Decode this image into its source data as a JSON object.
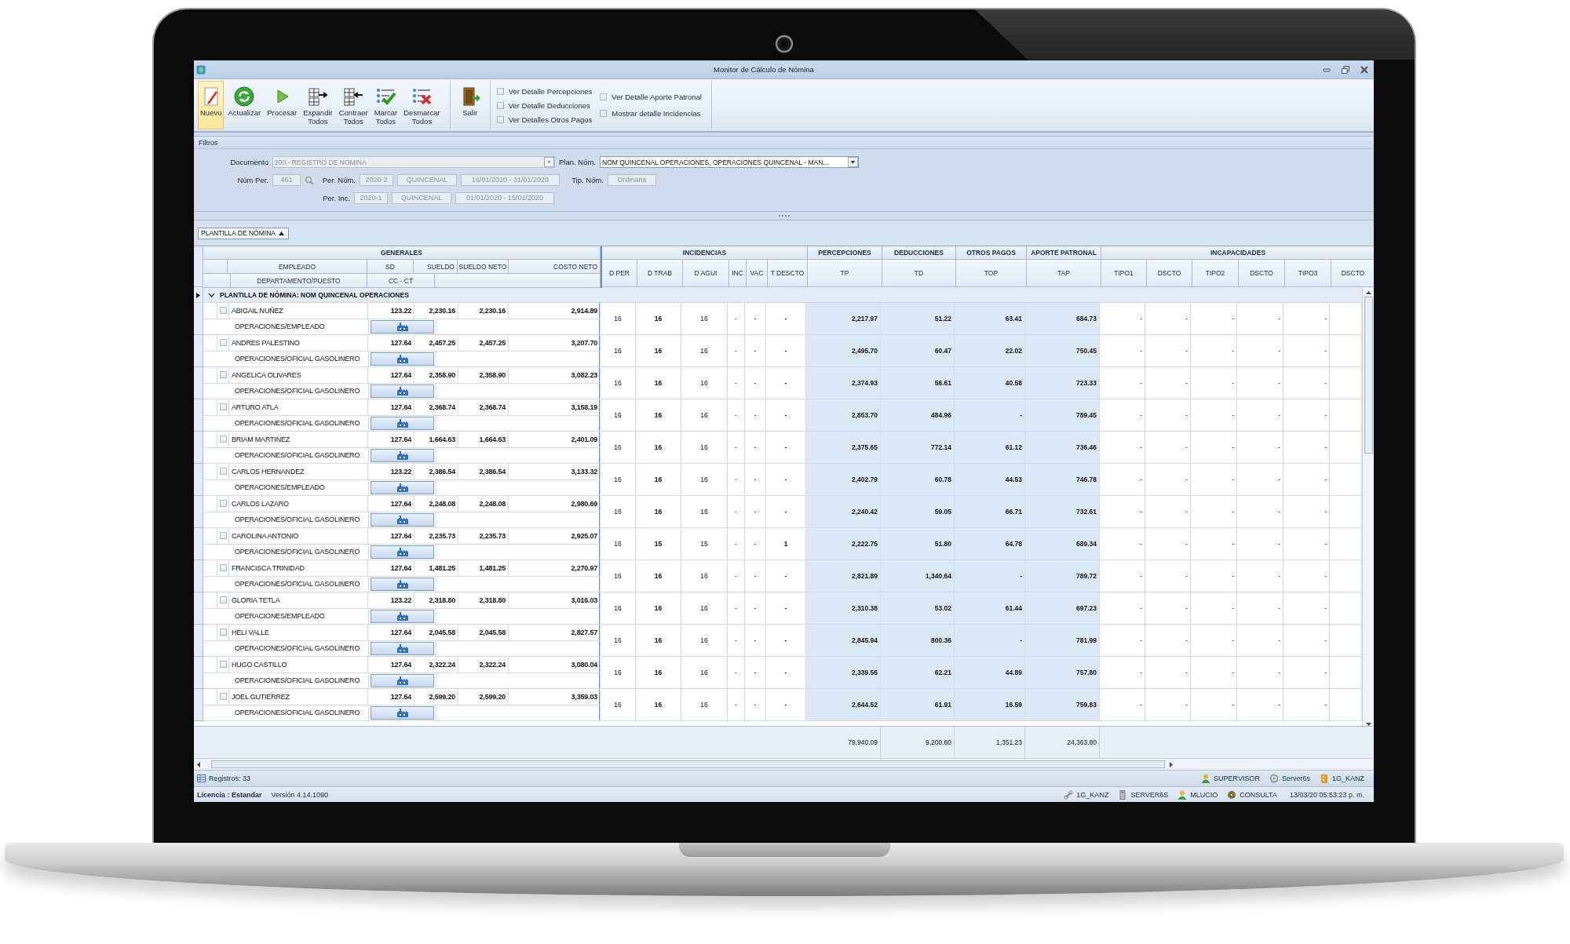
{
  "window": {
    "title": "Monitor de Cálculo de Nómina"
  },
  "toolbar": {
    "buttons": [
      {
        "label": "Nuevo",
        "selected": true
      },
      {
        "label": "Actualizar",
        "selected": false
      },
      {
        "label": "Procesar",
        "selected": false
      },
      {
        "label": "Expandir Todos",
        "selected": false
      },
      {
        "label": "Contraer Todos",
        "selected": false
      },
      {
        "label": "Marcar Todos",
        "selected": false
      },
      {
        "label": "Desmarcar Todos",
        "selected": false
      },
      {
        "label": "Salir",
        "selected": false
      }
    ],
    "options": [
      {
        "label": "Ver Detalle Percepciones",
        "checked": false
      },
      {
        "label": "Ver Detalle Deducciones",
        "checked": false
      },
      {
        "label": "Ver Detalles Otros Pagos",
        "checked": false
      },
      {
        "label": "Ver Detalle Aporte Patronal",
        "checked": false
      },
      {
        "label": "Mostrar detalle Incidencias",
        "checked": false
      }
    ]
  },
  "filters": {
    "title": "Filtros",
    "documento": {
      "label": "Documento",
      "value": "200 - REGISTRO DE NOMINA",
      "disabled": true
    },
    "plan_nom": {
      "label": "Plan. Nóm.",
      "value": "NOM QUINCENAL OPERACIONES, OPERACIONES QUINCENAL - MAN...",
      "disabled": false
    },
    "num_per": {
      "label": "Núm Per.",
      "value": "461"
    },
    "per_nom": {
      "label": "Per. Nóm.",
      "values": [
        "2020-2",
        "QUINCENAL",
        "16/01/2020 - 31/01/2020"
      ]
    },
    "tip_nom": {
      "label": "Tip. Nóm.",
      "value": "Ordinaria"
    },
    "per_inc": {
      "label": "Per. Inc.",
      "values": [
        "2020-1",
        "QUINCENAL",
        "01/01/2020 - 15/01/2020"
      ]
    }
  },
  "grid": {
    "layout_selector": "PLANTILLA DE NÓMINA",
    "column_groups": [
      "GENERALES",
      "INCIDENCIAS",
      "PERCEPCIONES",
      "DEDUCCIONES",
      "OTROS PAGOS",
      "APORTE PATRONAL",
      "INCAPACIDADES"
    ],
    "left_columns": [
      "EMPLEADO",
      "SD",
      "SUELDO",
      "SUELDO NETO",
      "COSTO NETO"
    ],
    "left_columns_2": [
      "DEPARTAMENTO/PUESTO",
      "CC - CT"
    ],
    "right_columns": [
      "D PER",
      "D TRAB",
      "D AGUI",
      "INC",
      "VAC",
      "T DESCTO",
      "TP",
      "TD",
      "TOP",
      "TAP",
      "TIPO1",
      "DSCTO",
      "TIPO2",
      "DSCTO",
      "TIPO3",
      "DSCTO"
    ],
    "group_row": {
      "label": "PLANTILLA DE NÓMINA: NOM QUINCENAL OPERACIONES",
      "expanded": true
    },
    "rows": [
      {
        "name": "ABIGAIL NUÑEZ",
        "checked": false,
        "sd": "123.22",
        "sueldo": "2,230.16",
        "sueldo_neto": "2,230.16",
        "costo_neto": "2,914.89",
        "puesto": "OPERACIONES/EMPLEADO",
        "values": [
          "16",
          "16",
          "16",
          "-",
          "-",
          "-",
          "2,217.97",
          "51.22",
          "63.41",
          "684.73",
          "-",
          "-",
          "-",
          "-",
          "-"
        ]
      },
      {
        "name": "ANDRES PALESTINO",
        "checked": false,
        "sd": "127.64",
        "sueldo": "2,457.25",
        "sueldo_neto": "2,457.25",
        "costo_neto": "3,207.70",
        "puesto": "OPERACIONES/OFICIAL GASOLINERO",
        "values": [
          "16",
          "16",
          "16",
          "-",
          "-",
          "-",
          "2,495.70",
          "60.47",
          "22.02",
          "750.45",
          "-",
          "-",
          "-",
          "-",
          "-"
        ]
      },
      {
        "name": "ANGELICA OLIVARES",
        "checked": false,
        "sd": "127.64",
        "sueldo": "2,358.90",
        "sueldo_neto": "2,358.90",
        "costo_neto": "3,082.23",
        "puesto": "OPERACIONES/OFICIAL GASOLINERO",
        "values": [
          "16",
          "16",
          "16",
          "-",
          "-",
          "-",
          "2,374.93",
          "56.61",
          "40.58",
          "723.33",
          "-",
          "-",
          "-",
          "-",
          "-"
        ]
      },
      {
        "name": "ARTURO ATLA",
        "checked": false,
        "sd": "127.64",
        "sueldo": "2,368.74",
        "sueldo_neto": "2,368.74",
        "costo_neto": "3,158.19",
        "puesto": "OPERACIONES/OFICIAL GASOLINERO",
        "values": [
          "16",
          "16",
          "16",
          "-",
          "-",
          "-",
          "2,853.70",
          "484.96",
          "-",
          "789.45",
          "-",
          "-",
          "-",
          "-",
          "-"
        ]
      },
      {
        "name": "BRIAM MARTINEZ",
        "checked": false,
        "sd": "127.64",
        "sueldo": "1,664.63",
        "sueldo_neto": "1,664.63",
        "costo_neto": "2,401.09",
        "puesto": "OPERACIONES/OFICIAL GASOLINERO",
        "values": [
          "16",
          "16",
          "16",
          "-",
          "-",
          "-",
          "2,375.65",
          "772.14",
          "61.12",
          "736.46",
          "-",
          "-",
          "-",
          "-",
          "-"
        ]
      },
      {
        "name": "CARLOS HERNANDEZ",
        "checked": false,
        "sd": "123.22",
        "sueldo": "2,386.54",
        "sueldo_neto": "2,386.54",
        "costo_neto": "3,133.32",
        "puesto": "OPERACIONES/EMPLEADO",
        "values": [
          "16",
          "16",
          "16",
          "-",
          "-",
          "-",
          "2,402.79",
          "60.78",
          "44.53",
          "746.78",
          "-",
          "-",
          "-",
          "-",
          "-"
        ]
      },
      {
        "name": "CARLOS LAZARO",
        "checked": false,
        "sd": "127.64",
        "sueldo": "2,248.08",
        "sueldo_neto": "2,248.08",
        "costo_neto": "2,980.69",
        "puesto": "OPERACIONES/OFICIAL GASOLINERO",
        "values": [
          "16",
          "16",
          "16",
          "-",
          "-",
          "-",
          "2,240.42",
          "59.05",
          "66.71",
          "732.61",
          "-",
          "-",
          "-",
          "-",
          "-"
        ]
      },
      {
        "name": "CAROLINA ANTONIO",
        "checked": false,
        "sd": "127.64",
        "sueldo": "2,235.73",
        "sueldo_neto": "2,235.73",
        "costo_neto": "2,925.07",
        "puesto": "OPERACIONES/OFICIAL GASOLINERO",
        "values": [
          "16",
          "15",
          "15",
          "-",
          "-",
          "1",
          "2,222.75",
          "51.80",
          "64.78",
          "689.34",
          "-",
          "-",
          "-",
          "-",
          "-"
        ]
      },
      {
        "name": "FRANCISCA TRINIDAD",
        "checked": false,
        "sd": "127.64",
        "sueldo": "1,481.25",
        "sueldo_neto": "1,481.25",
        "costo_neto": "2,270.97",
        "puesto": "OPERACIONES/OFICIAL GASOLINERO",
        "values": [
          "16",
          "16",
          "16",
          "-",
          "-",
          "-",
          "2,821.89",
          "1,340.64",
          "-",
          "789.72",
          "-",
          "-",
          "-",
          "-",
          "-"
        ]
      },
      {
        "name": "GLORIA TETLA",
        "checked": false,
        "sd": "123.22",
        "sueldo": "2,318.80",
        "sueldo_neto": "2,318.80",
        "costo_neto": "3,016.03",
        "puesto": "OPERACIONES/EMPLEADO",
        "values": [
          "16",
          "16",
          "16",
          "-",
          "-",
          "-",
          "2,310.38",
          "53.02",
          "61.44",
          "697.23",
          "-",
          "-",
          "-",
          "-",
          "-"
        ]
      },
      {
        "name": "HELI VALLE",
        "checked": false,
        "sd": "127.64",
        "sueldo": "2,045.58",
        "sueldo_neto": "2,045.58",
        "costo_neto": "2,827.57",
        "puesto": "OPERACIONES/OFICIAL GASOLINERO",
        "values": [
          "16",
          "16",
          "16",
          "-",
          "-",
          "-",
          "2,845.94",
          "800.36",
          "-",
          "781.99",
          "-",
          "-",
          "-",
          "-",
          "-"
        ]
      },
      {
        "name": "HUGO CASTILLO",
        "checked": false,
        "sd": "127.64",
        "sueldo": "2,322.24",
        "sueldo_neto": "2,322.24",
        "costo_neto": "3,080.04",
        "puesto": "OPERACIONES/OFICIAL GASOLINERO",
        "values": [
          "16",
          "16",
          "16",
          "-",
          "-",
          "-",
          "2,339.56",
          "62.21",
          "44.89",
          "757.80",
          "-",
          "-",
          "-",
          "-",
          "-"
        ]
      },
      {
        "name": "JOEL GUTIERREZ",
        "checked": false,
        "sd": "127.64",
        "sueldo": "2,599.20",
        "sueldo_neto": "2,599.20",
        "costo_neto": "3,359.03",
        "puesto": "OPERACIONES/OFICIAL GASOLINERO",
        "values": [
          "16",
          "16",
          "16",
          "-",
          "-",
          "-",
          "2,644.52",
          "61.91",
          "16.59",
          "759.83",
          "-",
          "-",
          "-",
          "-",
          "-"
        ]
      }
    ],
    "totals": [
      "79,940.09",
      "9,200.60",
      "1,351.23",
      "24,363.80"
    ]
  },
  "status_bar": {
    "records": "Registros: 33",
    "items": [
      "SUPERVISOR",
      "Server6s",
      "1G_KANZ"
    ]
  },
  "license_bar": {
    "license": "Licencia : Estandar",
    "version": "Versión 4.14.1090",
    "items": [
      "1G_KANZ",
      "SERVER6S",
      "MLUCIO",
      "CONSULTA"
    ],
    "datetime": "13/03/20 05:53:23 p. m."
  }
}
